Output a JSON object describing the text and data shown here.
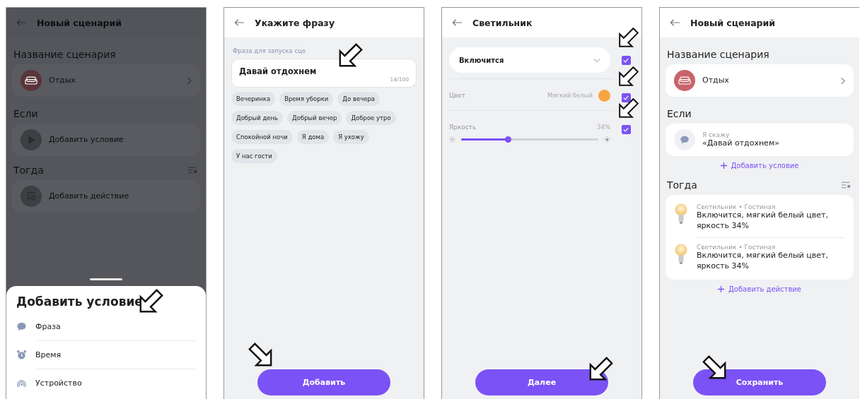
{
  "screens": [
    {
      "kind": "sheet",
      "title": "Новый сценарий",
      "name_heading": "Название сценария",
      "name_value": "Отдых",
      "if_heading": "Если",
      "if_item": "Добавить условие",
      "then_heading": "Тогда",
      "then_item": "Добавить действие",
      "sheet": {
        "title": "Добавить условие",
        "options": [
          {
            "label": "Фраза",
            "kind": "speech"
          },
          {
            "label": "Время",
            "kind": "alarm"
          },
          {
            "label": "Устройство",
            "kind": "signal"
          }
        ]
      }
    },
    {
      "kind": "phrase",
      "title": "Укажите фразу",
      "field_label": "Фраза для запуска сце",
      "value": "Давай отдохнем",
      "counter": "14/100",
      "chips": [
        "Вечеринка",
        "Время уборки",
        "До вечера",
        "Добрый день",
        "Добрый вечер",
        "Доброе утро",
        "Спокойной ночи",
        "Я дома",
        "Я ухожу",
        "У нас гости"
      ],
      "button": "Добавить"
    },
    {
      "kind": "device",
      "title": "Светильник",
      "rows": [
        {
          "kind": "dropdown",
          "value": "Включится",
          "checked": true
        },
        {
          "kind": "color",
          "label": "Цвет",
          "value": "Мягкий белый",
          "color": "#f7a541",
          "checked": true
        },
        {
          "kind": "slider",
          "label": "Яркость",
          "reading": "34%",
          "level": 0.34,
          "checked": true
        }
      ],
      "button": "Далее"
    },
    {
      "kind": "summary",
      "title": "Новый сценарий",
      "name_heading": "Название сценария",
      "name_value": "Отдых",
      "if_heading": "Если",
      "conditions": [
        {
          "caption": "Я скажу",
          "text": "«Давай отдохнем»"
        }
      ],
      "add_condition": "Добавить условие",
      "then_heading": "Тогда",
      "actions": [
        {
          "caption": "Светильник • Гостиная",
          "text": "Включится, мягкий белый цвет, яркость 34%"
        },
        {
          "caption": "Светильник • Гостиная",
          "text": "Включится, мягкий белый цвет, яркость 34%"
        }
      ],
      "add_action": "Добавить действие",
      "button": "Сохранить"
    }
  ]
}
